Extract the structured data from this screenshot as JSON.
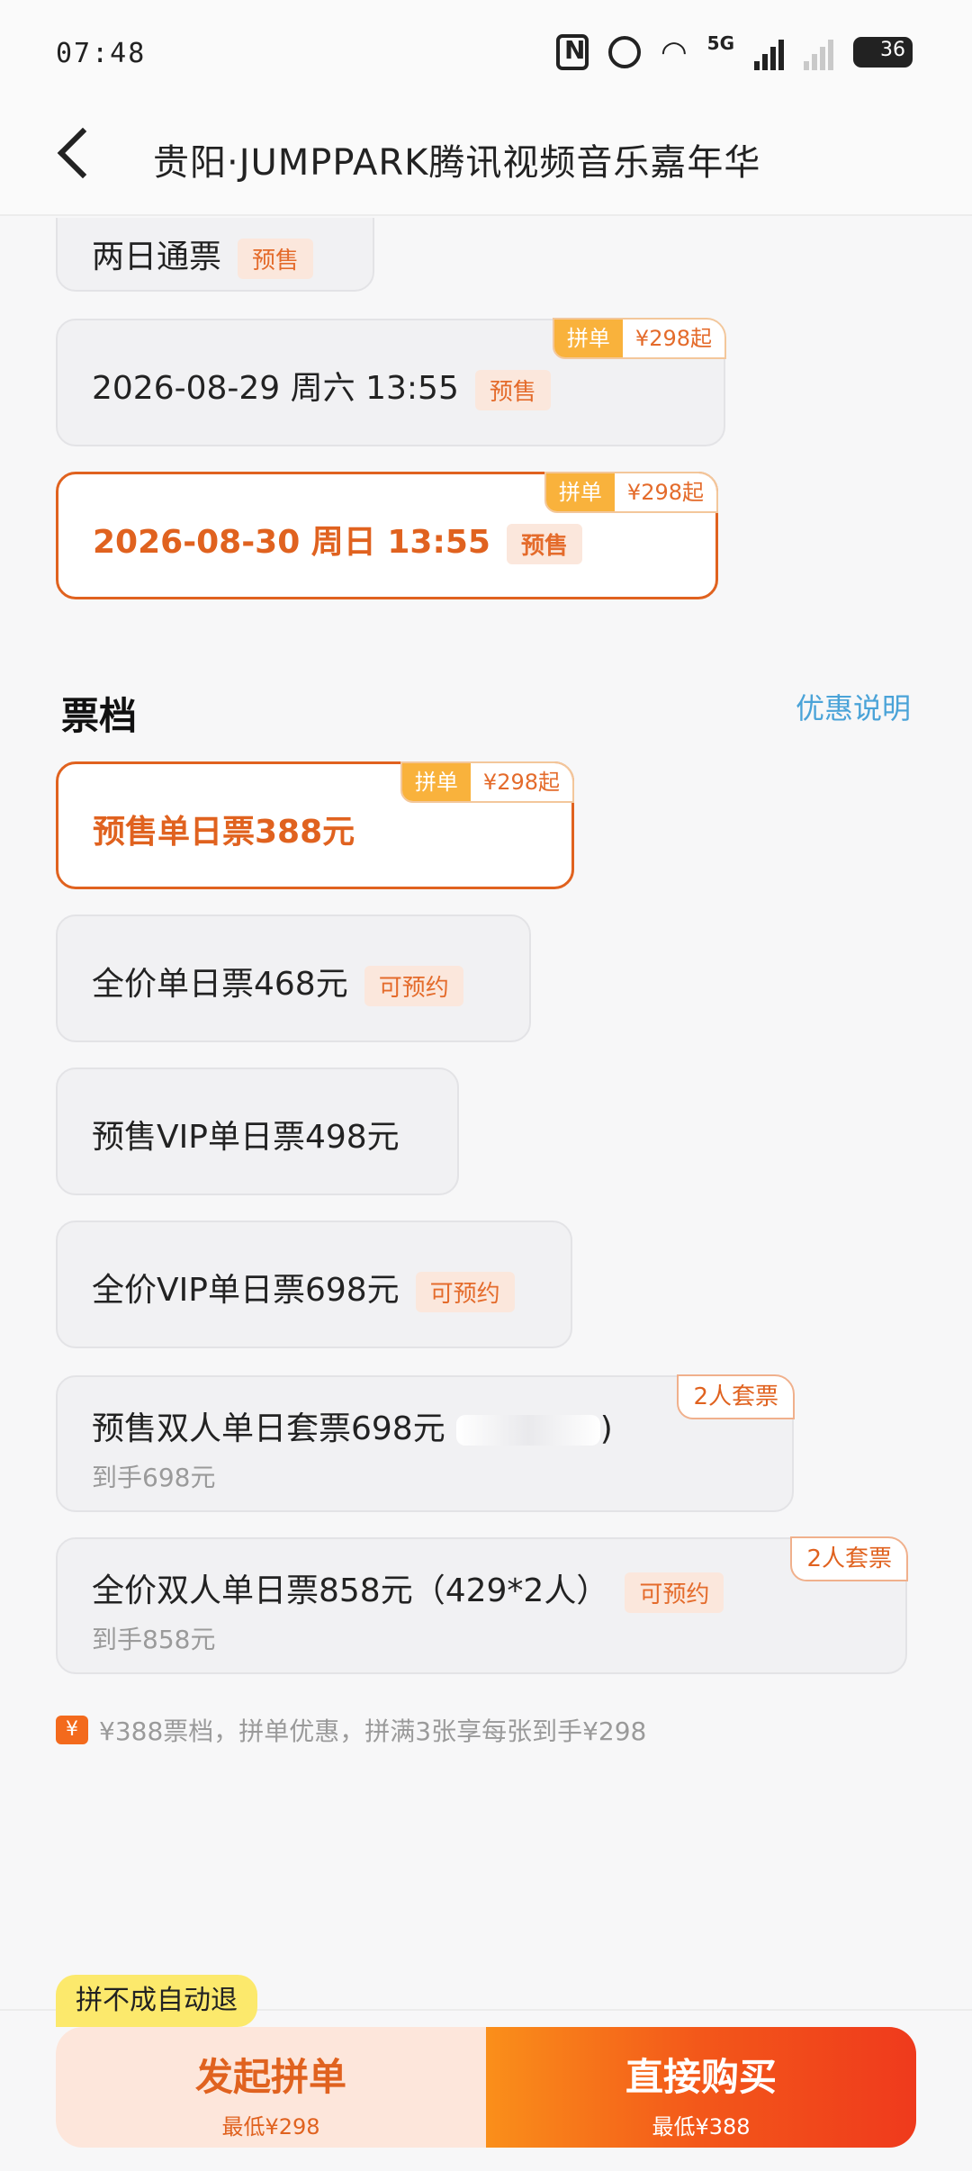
{
  "status": {
    "time": "07:48",
    "network": "5G",
    "battery": "36"
  },
  "header": {
    "title": "贵阳·JUMPPARK腾讯视频音乐嘉年华"
  },
  "sessions": [
    {
      "label": "两日通票",
      "tag": "预售"
    },
    {
      "label": "2026-08-29 周六 13:55",
      "tag": "预售",
      "badge_left": "拼单",
      "badge_right": "¥298起"
    },
    {
      "label": "2026-08-30 周日 13:55",
      "tag": "预售",
      "badge_left": "拼单",
      "badge_right": "¥298起",
      "selected": true
    }
  ],
  "ticket_section": {
    "title": "票档",
    "link": "优惠说明"
  },
  "tickets": [
    {
      "label": "预售单日票388元",
      "badge_left": "拼单",
      "badge_right": "¥298起",
      "selected": true
    },
    {
      "label": "全价单日票468元",
      "tag": "可预约"
    },
    {
      "label": "预售VIP单日票498元"
    },
    {
      "label": "全价VIP单日票698元",
      "tag": "可预约"
    },
    {
      "label": "预售双人单日套票698元",
      "label_tail": ")",
      "sub": "到手698元",
      "corner": "2人套票"
    },
    {
      "label": "全价双人单日票858元（429*2人）",
      "tag": "可预约",
      "sub": "到手858元",
      "corner": "2人套票"
    }
  ],
  "note": {
    "icon": "yen-icon",
    "text": "¥388票档，拼单优惠，拼满3张享每张到手¥298"
  },
  "bottom": {
    "tip": "拼不成自动退",
    "left_main": "发起拼单",
    "left_sub": "最低¥298",
    "right_main": "直接购买",
    "right_sub": "最低¥388"
  },
  "colors": {
    "accent": "#e0621f",
    "tag_bg": "#fbe7dc",
    "badge_yellow": "#f9b23c",
    "link": "#4aa3d8"
  }
}
